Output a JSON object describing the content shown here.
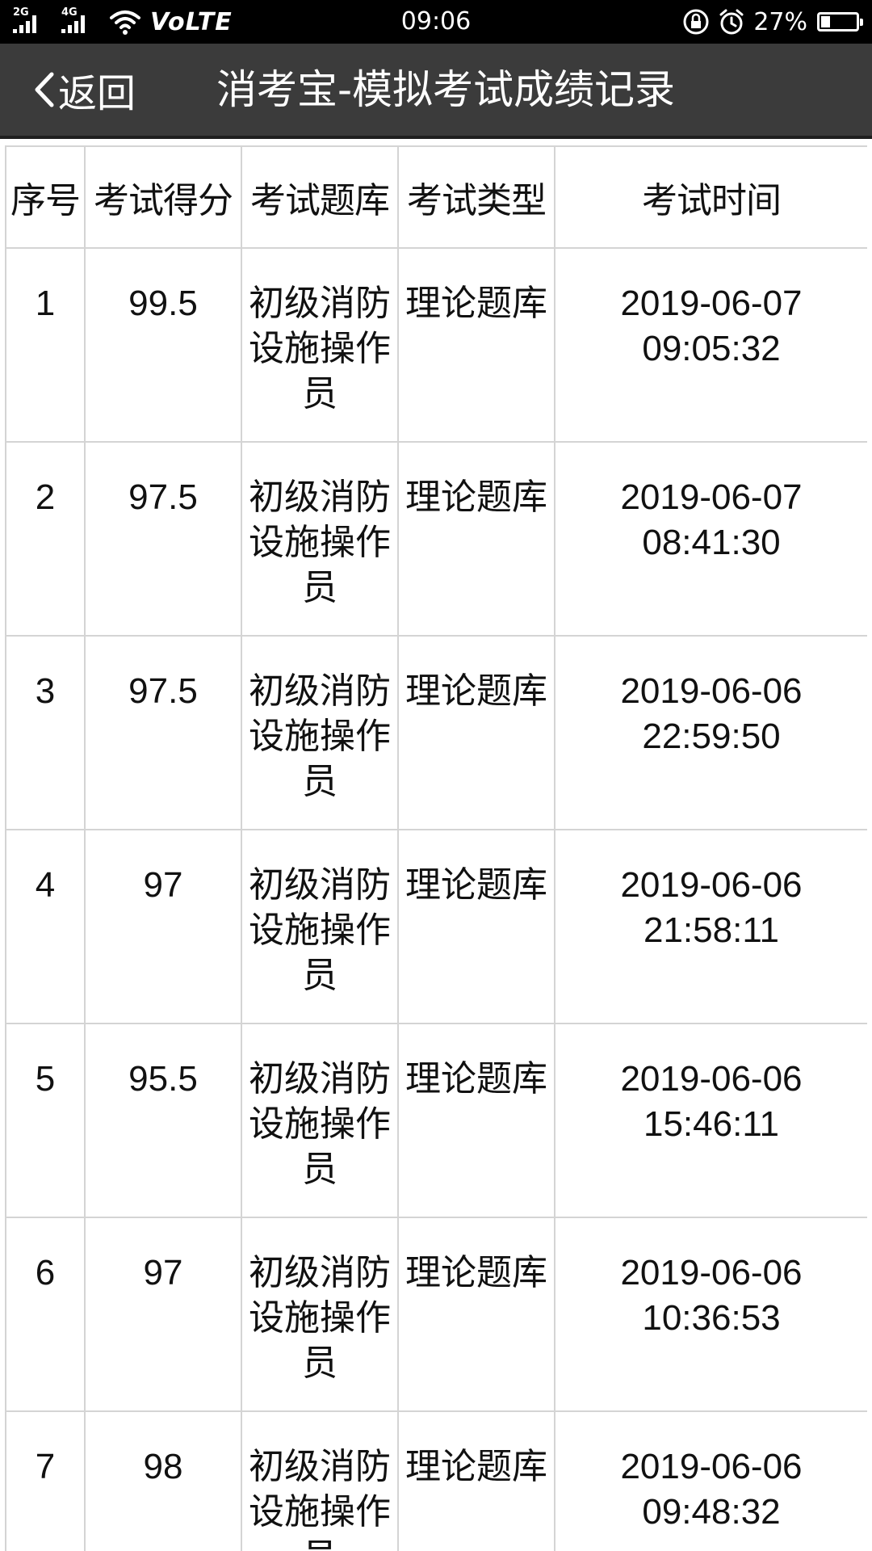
{
  "status_bar": {
    "sim1_tag": "2G",
    "sim2_tag": "4G",
    "volte": "VoLTE",
    "time": "09:06",
    "battery": "27%",
    "battery_level": 0.27
  },
  "nav": {
    "back_label": "返回",
    "title": "消考宝-模拟考试成绩记录"
  },
  "table": {
    "headers": {
      "index": "序号",
      "score": "考试得分",
      "bank": "考试题库",
      "type": "考试类型",
      "time": "考试时间"
    },
    "rows": [
      {
        "index": "1",
        "score": "99.5",
        "bank": "初级消防设施操作员",
        "type": "理论题库",
        "date": "2019-06-07",
        "clock": "09:05:32"
      },
      {
        "index": "2",
        "score": "97.5",
        "bank": "初级消防设施操作员",
        "type": "理论题库",
        "date": "2019-06-07",
        "clock": "08:41:30"
      },
      {
        "index": "3",
        "score": "97.5",
        "bank": "初级消防设施操作员",
        "type": "理论题库",
        "date": "2019-06-06",
        "clock": "22:59:50"
      },
      {
        "index": "4",
        "score": "97",
        "bank": "初级消防设施操作员",
        "type": "理论题库",
        "date": "2019-06-06",
        "clock": "21:58:11"
      },
      {
        "index": "5",
        "score": "95.5",
        "bank": "初级消防设施操作员",
        "type": "理论题库",
        "date": "2019-06-06",
        "clock": "15:46:11"
      },
      {
        "index": "6",
        "score": "97",
        "bank": "初级消防设施操作员",
        "type": "理论题库",
        "date": "2019-06-06",
        "clock": "10:36:53"
      },
      {
        "index": "7",
        "score": "98",
        "bank": "初级消防设施操作员",
        "type": "理论题库",
        "date": "2019-06-06",
        "clock": "09:48:32"
      }
    ]
  }
}
